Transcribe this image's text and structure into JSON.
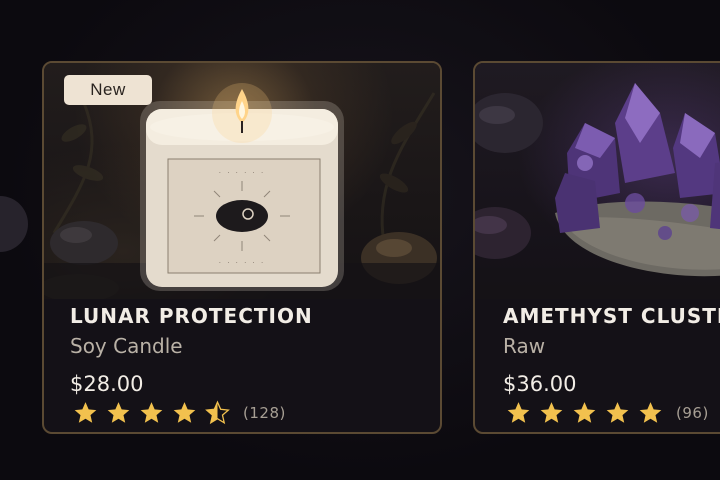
{
  "products": [
    {
      "badge": "New",
      "name": "LUNAR PROTECTION",
      "subtitle": "Soy Candle",
      "price": "$28.00",
      "rating": 4.5,
      "review_count": "(128)"
    },
    {
      "name": "AMETHYST CLUSTER",
      "subtitle": "Raw",
      "price": "$36.00",
      "rating": 5,
      "review_count": "(96)"
    }
  ],
  "colors": {
    "background": "#0e0c12",
    "card_border": "#5b4a33",
    "star": "#f2c14e",
    "text_primary": "#f2ede6",
    "text_secondary": "#b9b1a6",
    "badge_bg": "#eee3d3"
  },
  "icons": {
    "scroll_prev": "chevron-left-icon",
    "star": "star-icon"
  }
}
